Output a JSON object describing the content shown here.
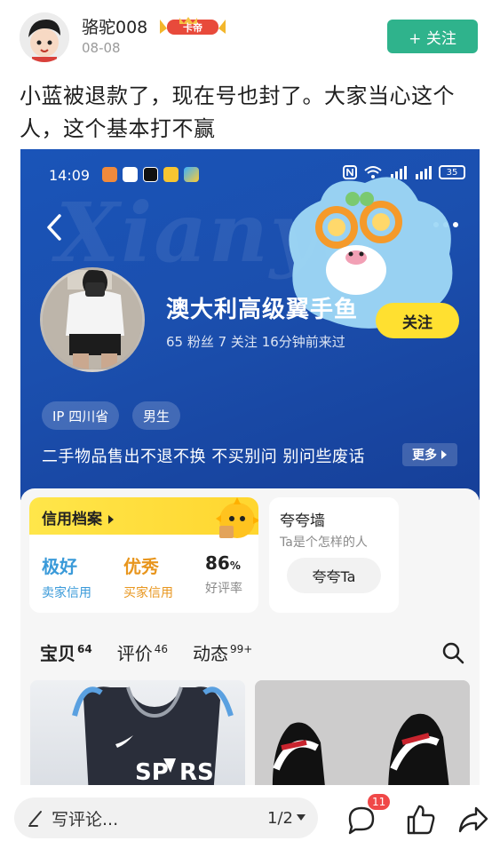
{
  "post": {
    "user_name": "骆驼008",
    "vip_badge": "卡帝",
    "date": "08-08",
    "follow_label": "+ 关注",
    "text": "小蓝被退款了，现在号也封了。大家当心这个人，这个基本打不赢"
  },
  "screenshot": {
    "status_time": "14:09",
    "battery": "35",
    "bg_word": "Xianyu",
    "seller": {
      "name": "澳大利高级翼手鱼",
      "stats": "65 粉丝   7 关注   16分钟前来过",
      "follow_label": "关注",
      "tags": [
        "IP 四川省",
        "男生"
      ],
      "bio": "二手物品售出不退不换 不买别问 别问些废话",
      "more_label": "更多"
    },
    "credit": {
      "title": "信用档案",
      "items": [
        {
          "value": "极好",
          "label": "卖家信用",
          "color": "#3a9ad9"
        },
        {
          "value": "优秀",
          "label": "买家信用",
          "color": "#e8961e"
        },
        {
          "value": "86",
          "unit": "%",
          "label": "好评率",
          "color": "#222222"
        }
      ]
    },
    "praise": {
      "title": "夸夸墙",
      "subtitle": "Ta是个怎样的人",
      "button": "夸夸Ta"
    },
    "tabs": [
      {
        "label": "宝贝",
        "count": "64"
      },
      {
        "label": "评价",
        "count": "46"
      },
      {
        "label": "动态",
        "count": "99+"
      }
    ]
  },
  "bottom_bar": {
    "comment_placeholder": "写评论...",
    "page_indicator": "1/2",
    "comment_badge": "11"
  },
  "colors": {
    "accent_green": "#2fb38c",
    "xianyu_blue": "#1a54b8",
    "xianyu_yellow": "#ffe030"
  }
}
